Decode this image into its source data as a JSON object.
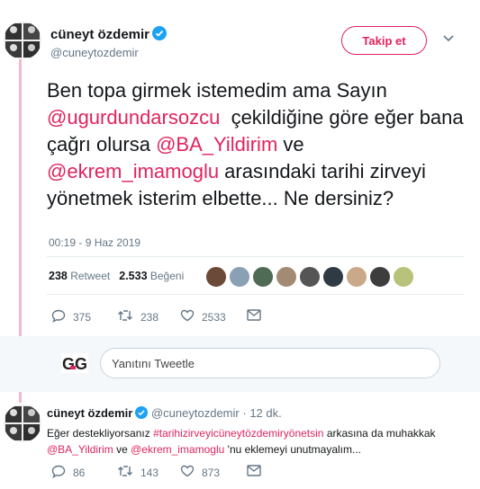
{
  "tweet": {
    "author_name": "cüneyt özdemir",
    "author_handle": "@cuneytozdemir",
    "follow_label": "Takip et",
    "text_segments": [
      {
        "t": "Ben topa girmek istemedim ama Sayın ",
        "mention": false
      },
      {
        "t": "@ugurdundarsozcu",
        "mention": true
      },
      {
        "t": "  çekildiğine göre eğer bana çağrı olursa ",
        "mention": false
      },
      {
        "t": "@BA_Yildirim",
        "mention": true
      },
      {
        "t": " ve ",
        "mention": false
      },
      {
        "t": "@ekrem_imamoglu",
        "mention": true
      },
      {
        "t": " arasındaki tarihi zirveyi yönetmek isterim elbette... Ne dersiniz?",
        "mention": false
      }
    ],
    "timestamp": "00:19 - 9 Haz 2019",
    "retweet_count": "238",
    "retweet_label": "Retweet",
    "like_count": "2.533",
    "like_label": "Beğeni",
    "actions": {
      "replies": "375",
      "retweets": "238",
      "likes": "2533"
    }
  },
  "reply_box": {
    "placeholder": "Yanıtını Tweetle",
    "logo_text": "GG"
  },
  "reply_tweet": {
    "author_name": "cüneyt özdemir",
    "author_handle": "@cuneytozdemir",
    "separator": "·",
    "age": "12 dk.",
    "text_segments": [
      {
        "t": "Eğer destekliyorsanız ",
        "mention": false
      },
      {
        "t": "#tarihizirveyicüneytözdemiryönetsin",
        "mention": true
      },
      {
        "t": " arkasına da muhakkak ",
        "mention": false
      },
      {
        "t": "@BA_Yildirim",
        "mention": true
      },
      {
        "t": " ve ",
        "mention": false
      },
      {
        "t": "@ekrem_imamoglu",
        "mention": true
      },
      {
        "t": " 'nu eklemeyi unutmayalım...",
        "mention": false
      }
    ],
    "actions": {
      "replies": "86",
      "retweets": "143",
      "likes": "873"
    }
  },
  "colors": {
    "accent": "#e0245e",
    "thread_line": "#f2b8d3",
    "muted": "#657786",
    "verified": "#1da1f2"
  },
  "icons": [
    "verified-badge-icon",
    "chevron-down-icon",
    "reply-icon",
    "retweet-icon",
    "heart-icon",
    "message-icon"
  ]
}
